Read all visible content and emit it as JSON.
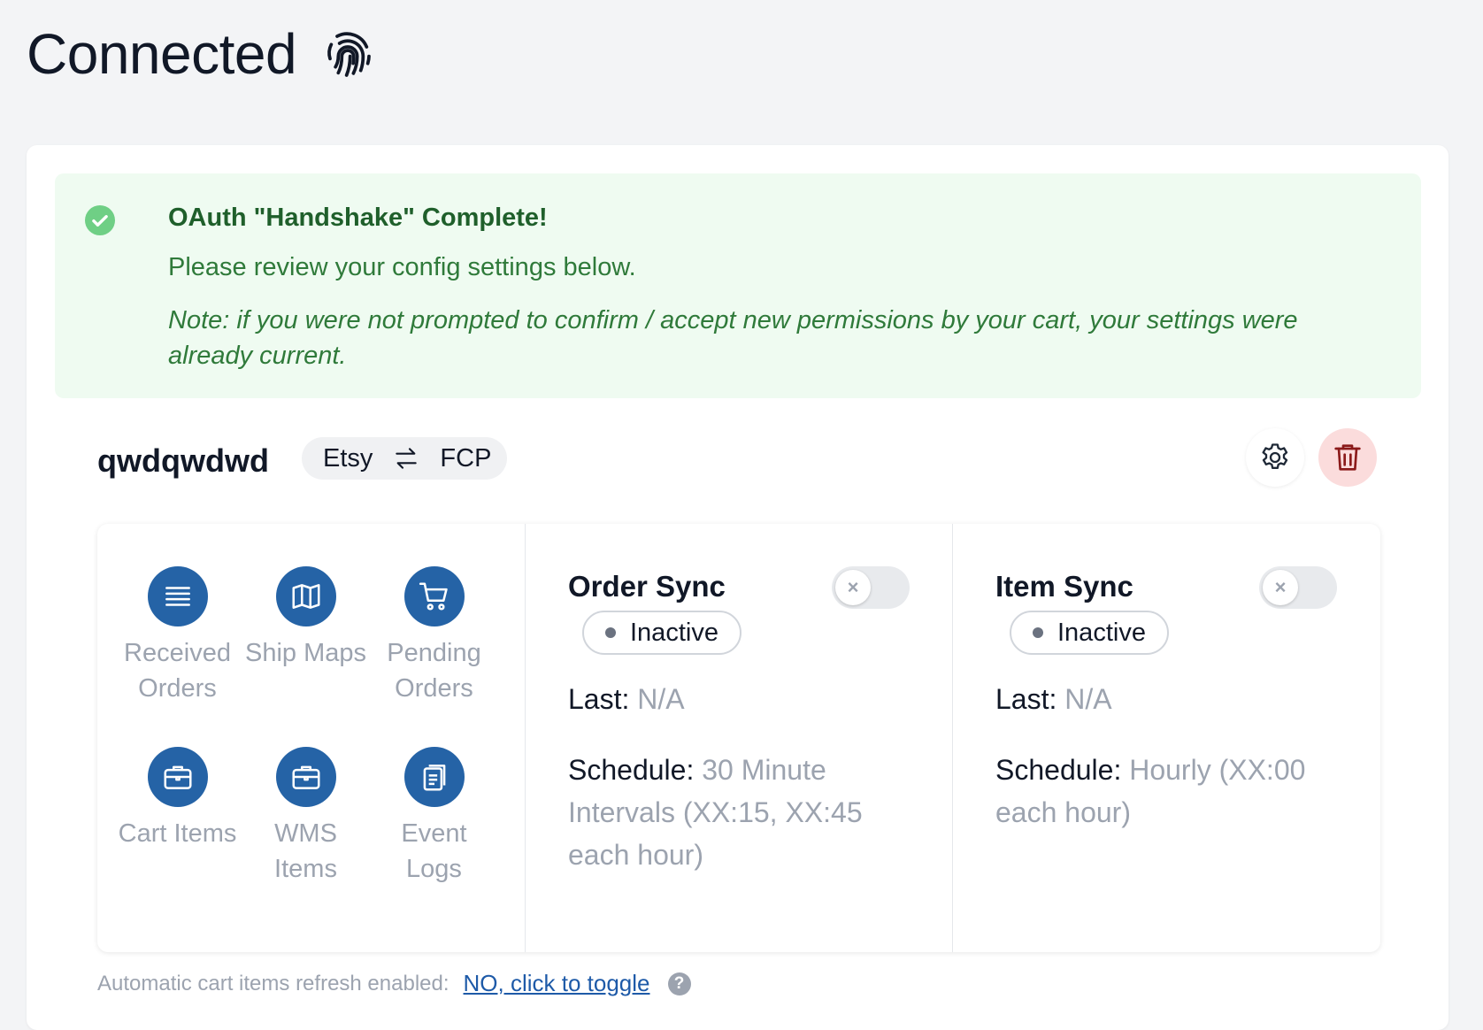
{
  "header": {
    "title": "Connected",
    "icon": "fingerprint-icon"
  },
  "alert": {
    "title": "OAuth \"Handshake\" Complete!",
    "line": "Please review your config settings below.",
    "note": "Note: if you were not prompted to confirm / accept new permissions by your cart, your settings were already current.",
    "color": "#2f7a3a"
  },
  "integration": {
    "name": "qwdqwdwd",
    "source": "Etsy",
    "target": "FCP"
  },
  "nav": {
    "received_orders": "Received Orders",
    "ship_maps": "Ship Maps",
    "pending_orders": "Pending Orders",
    "cart_items": "Cart Items",
    "wms_items": "WMS Items",
    "event_logs": "Event Logs"
  },
  "order_sync": {
    "title": "Order Sync",
    "status": "Inactive",
    "last_label": "Last:",
    "last_value": "N/A",
    "schedule_label": "Schedule:",
    "schedule_value": "30 Minute Intervals (XX:15, XX:45 each hour)"
  },
  "item_sync": {
    "title": "Item Sync",
    "status": "Inactive",
    "last_label": "Last:",
    "last_value": "N/A",
    "schedule_label": "Schedule:",
    "schedule_value": "Hourly (XX:00 each hour)"
  },
  "footer": {
    "label": "Automatic cart items refresh enabled:",
    "toggle_link": "NO, click to toggle",
    "help": "?"
  },
  "colors": {
    "accent": "#2563a6",
    "danger_bg": "#fbdcdc",
    "success_bg": "#effbf1"
  }
}
